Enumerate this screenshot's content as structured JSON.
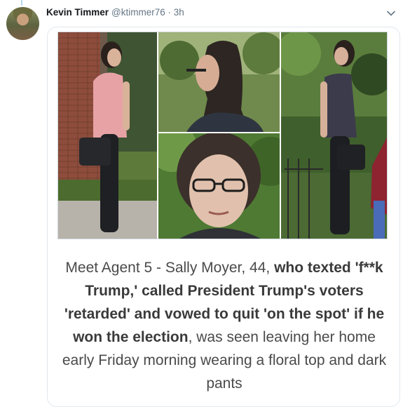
{
  "tweet": {
    "author": {
      "display_name": "Kevin Timmer",
      "handle": "@ktimmer76",
      "time": " · 3h"
    },
    "menu_icon": "chevron-down-icon"
  },
  "article": {
    "intro": "Meet Agent 5 - Sally Moyer, 44, ",
    "bold1": "who texted 'f**k Trump,' called President Trump's voters 'retarded' and vowed to quit 'on the spot' if he won the election",
    "rest": ", was seen leaving her home early Friday morning wearing a floral top and dark pants"
  },
  "collage_photos": [
    "photo-woman-walking-pink-top",
    "photo-woman-profile",
    "photo-woman-closeup-glasses",
    "photo-woman-walking-dark-top"
  ]
}
